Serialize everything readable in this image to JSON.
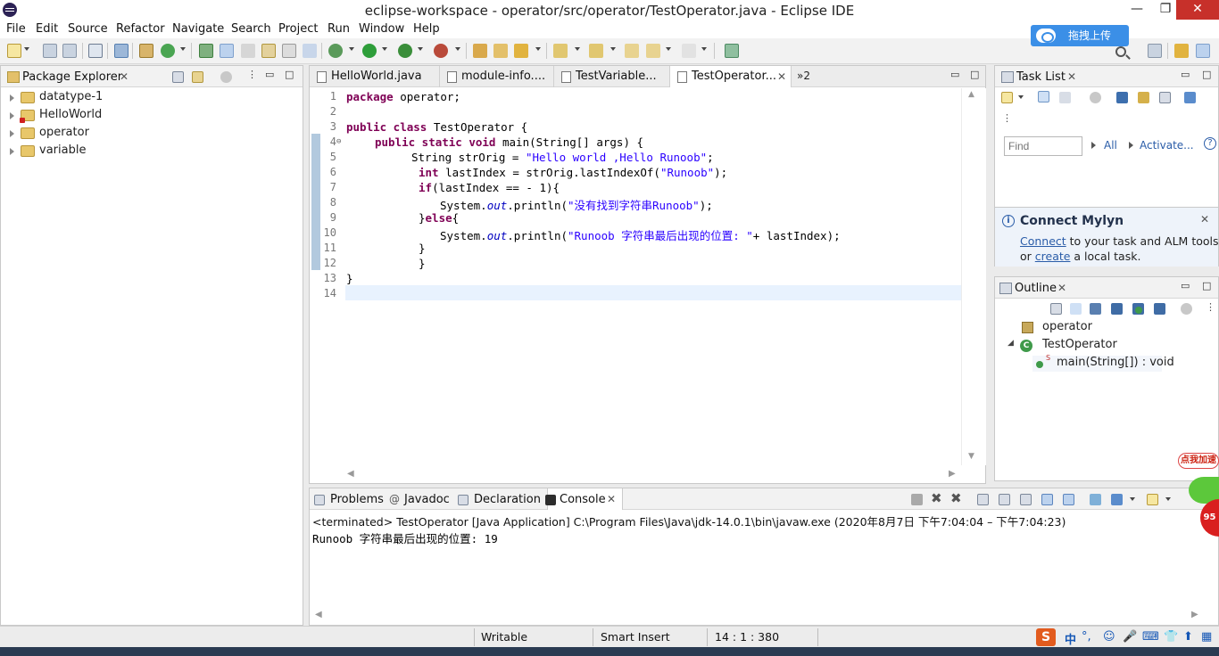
{
  "window": {
    "title": "eclipse-workspace - operator/src/operator/TestOperator.java - Eclipse IDE",
    "minimize": "—",
    "maximize": "❐",
    "close": "✕"
  },
  "menu": [
    "File",
    "Edit",
    "Source",
    "Refactor",
    "Navigate",
    "Search",
    "Project",
    "Run",
    "Window",
    "Help"
  ],
  "upload_button": "拖拽上传",
  "package_explorer": {
    "title": "Package Explorer",
    "items": [
      "datatype-1",
      "HelloWorld",
      "operator",
      "variable"
    ]
  },
  "editor": {
    "tabs": [
      "HelloWorld.java",
      "module-info....",
      "TestVariable...",
      "TestOperator..."
    ],
    "overflow": "»2",
    "line_numbers": [
      "1",
      "2",
      "3",
      "4",
      "5",
      "6",
      "7",
      "8",
      "9",
      "10",
      "11",
      "12",
      "13",
      "14"
    ],
    "code": {
      "l1_kw": "package",
      "l1_rest": " operator;",
      "l3_kw": "public class",
      "l3_rest": " TestOperator {",
      "l4_kw": "public static void",
      "l4_rest": " main(String[] args) {",
      "l5_a": "String strOrig = ",
      "l5_str": "\"Hello world ,Hello Runoob\"",
      "l5_end": ";",
      "l6_kw": "int",
      "l6_a": " lastIndex = strOrig.lastIndexOf(",
      "l6_str": "\"Runoob\"",
      "l6_end": ");",
      "l7_kw": "if",
      "l7_rest": "(lastIndex == - 1){",
      "l8_a": "System.",
      "l8_fld": "out",
      "l8_b": ".println(",
      "l8_str": "\"没有找到字符串Runoob\"",
      "l8_end": ");",
      "l9_a": "}",
      "l9_kw": "else",
      "l9_b": "{",
      "l10_a": "System.",
      "l10_fld": "out",
      "l10_b": ".println(",
      "l10_str": "\"Runoob 字符串最后出现的位置: \"",
      "l10_end": "+ lastIndex);",
      "l11": "}",
      "l12": "}",
      "l13": "}"
    }
  },
  "task_list": {
    "title": "Task List",
    "find_placeholder": "Find",
    "all_label": "All",
    "activate_label": "Activate...",
    "help": "?"
  },
  "mylyn": {
    "title": "Connect Mylyn",
    "info": "i",
    "connect_link": "Connect",
    "line1_rest": " to your task and ALM tools",
    "line2_pre": "or ",
    "create_link": "create",
    "line2_rest": " a local task."
  },
  "outline": {
    "title": "Outline",
    "package": "operator",
    "class": "TestOperator",
    "method": "main(String[]) : void",
    "static_mark": "S",
    "class_mark": "C"
  },
  "console": {
    "tabs": [
      "Problems",
      "Javadoc",
      "Declaration",
      "Console"
    ],
    "terminated": "<terminated> TestOperator [Java Application] C:\\Program Files\\Java\\jdk-14.0.1\\bin\\javaw.exe  (2020年8月7日 下午7:04:04 – 下午7:04:23)",
    "output": "Runoob 字符串最后出现的位置: 19"
  },
  "status": {
    "writable": "Writable",
    "insert_mode": "Smart Insert",
    "position": "14 : 1 : 380",
    "ime_logo": "S",
    "ime_mode": "中",
    "ime_punct": "°,"
  },
  "speed_widget": {
    "bubble": "点我加速",
    "value": "95"
  },
  "colors": {
    "keyword": "#7f0055",
    "string": "#2a00ff",
    "field": "#0000c0",
    "link": "#2a5ca8",
    "close_button": "#c7302a"
  }
}
